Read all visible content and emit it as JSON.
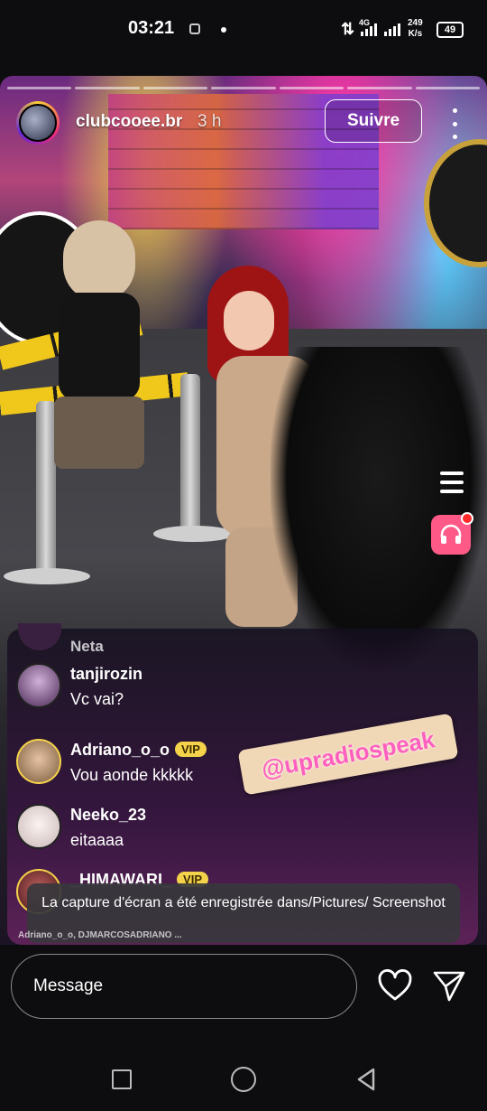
{
  "status_bar": {
    "time": "03:21",
    "data_arrows": "⇅",
    "network": "4G",
    "speed_value": "249",
    "speed_unit": "K/s",
    "battery": "49"
  },
  "live": {
    "host_name": "clubcooee.br",
    "elapsed": "3 h",
    "follow_label": "Suivre"
  },
  "comments": [
    {
      "user": "Neta",
      "text": ""
    },
    {
      "user": "tanjirozin",
      "text": "Vc vai?",
      "vip": ""
    },
    {
      "user": "Adriano_o_o",
      "text": "Vou aonde kkkkk",
      "vip": "VIP"
    },
    {
      "user": "Neeko_23",
      "text": "eitaaaa",
      "vip": ""
    },
    {
      "user": "_HIMAWARI_",
      "text": "",
      "vip": "VIP"
    }
  ],
  "sticker_text": "@upradiospeak",
  "toast": "La capture d'écran a été enregistrée dans/Pictures/ Screenshot",
  "joined_text": "Adriano_o_o, DJMARCOSADRIANO ...",
  "composer": {
    "placeholder": "Message"
  },
  "icons": {
    "more": "more-vertical-icon",
    "menu": "menu-lines-icon",
    "radio": "headphones-icon",
    "heart": "heart-icon",
    "send": "send-icon",
    "nav": [
      "recents-square-icon",
      "home-circle-icon",
      "back-triangle-icon"
    ]
  },
  "colors": {
    "vip_badge": "#f4d34a",
    "radio_button": "#ff5a87",
    "sticker_text": "#ff5fbf"
  }
}
